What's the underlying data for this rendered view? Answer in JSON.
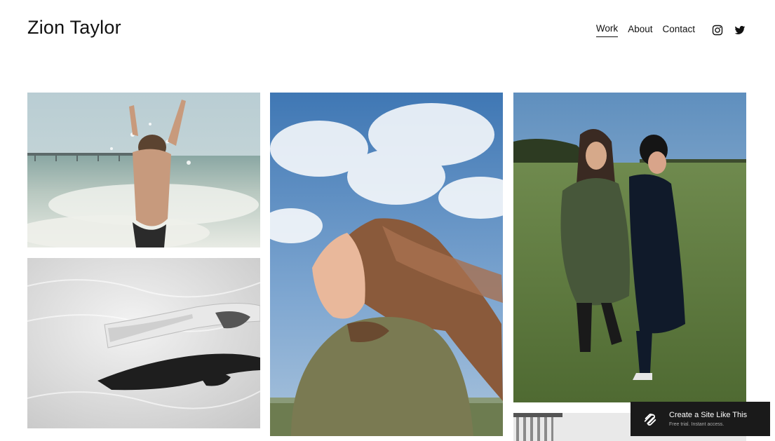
{
  "site": {
    "title": "Zion Taylor"
  },
  "nav": {
    "items": [
      {
        "label": "Work",
        "active": true
      },
      {
        "label": "About",
        "active": false
      },
      {
        "label": "Contact",
        "active": false
      }
    ],
    "social": [
      "instagram-icon",
      "twitter-icon"
    ]
  },
  "gallery": {
    "images": [
      {
        "name": "photo-beach-splash"
      },
      {
        "name": "photo-sand-shadow-bw"
      },
      {
        "name": "photo-windblown-hair"
      },
      {
        "name": "photo-two-walkers-field"
      },
      {
        "name": "photo-building-bw"
      }
    ]
  },
  "badge": {
    "title": "Create a Site Like This",
    "subtitle": "Free trial. Instant access.",
    "icon": "squarespace-logo-icon"
  },
  "colors": {
    "text": "#111111",
    "badge_bg": "#1a1a1a",
    "background": "#ffffff"
  }
}
